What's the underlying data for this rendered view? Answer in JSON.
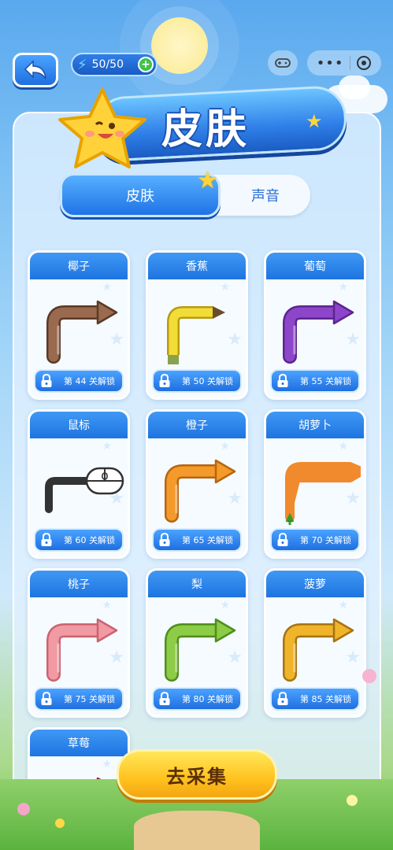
{
  "header": {
    "energy": "50/50",
    "title": "皮肤"
  },
  "tabs": [
    {
      "label": "皮肤",
      "active": true
    },
    {
      "label": "声音",
      "active": false
    }
  ],
  "skins": [
    {
      "name": "椰子",
      "unlock": "第 44 关解锁",
      "color": "#9a6a4f",
      "edge": "#5b3a27",
      "type": "arrow"
    },
    {
      "name": "香蕉",
      "unlock": "第 50 关解锁",
      "color": "#f2dc38",
      "edge": "#b89b10",
      "type": "pencil"
    },
    {
      "name": "葡萄",
      "unlock": "第 55 关解锁",
      "color": "#8d46c9",
      "edge": "#5a2690",
      "type": "arrow"
    },
    {
      "name": "鼠标",
      "unlock": "第 60 关解锁",
      "color": "#333333",
      "edge": "#111111",
      "type": "mouse"
    },
    {
      "name": "橙子",
      "unlock": "第 65 关解锁",
      "color": "#f49a2a",
      "edge": "#b86510",
      "type": "arrow"
    },
    {
      "name": "胡萝卜",
      "unlock": "第 70 关解锁",
      "color": "#f08a2c",
      "edge": "#b75a0e",
      "type": "carrot"
    },
    {
      "name": "桃子",
      "unlock": "第 75 关解锁",
      "color": "#f29aa4",
      "edge": "#c9646f",
      "type": "arrow"
    },
    {
      "name": "梨",
      "unlock": "第 80 关解锁",
      "color": "#8ccc46",
      "edge": "#4f8e1c",
      "type": "arrow"
    },
    {
      "name": "菠萝",
      "unlock": "第 85 关解锁",
      "color": "#f0b42a",
      "edge": "#a87312",
      "type": "arrow"
    },
    {
      "name": "草莓",
      "unlock": "",
      "color": "#e44c5a",
      "edge": "#a0222f",
      "type": "arrow"
    }
  ],
  "collect_button": "去采集",
  "icons": {
    "back": "back-arrow-icon",
    "energy": "lightning-icon",
    "lock": "lock-icon"
  }
}
